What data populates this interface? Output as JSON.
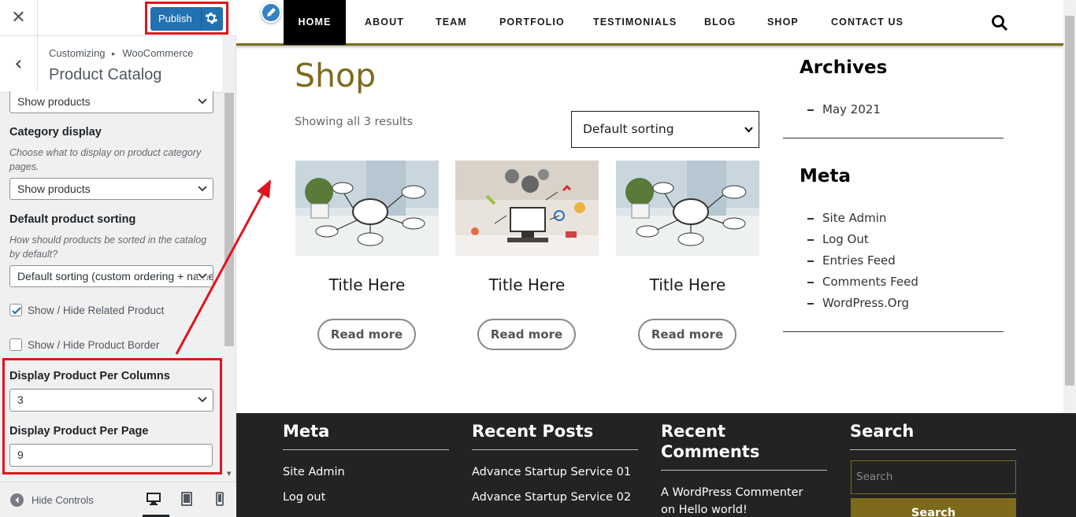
{
  "customizer": {
    "close_glyph": "✕",
    "publish_label": "Publish",
    "back_glyph": "‹",
    "breadcrumb": [
      "Customizing",
      "WooCommerce"
    ],
    "breadcrumb_sep": "▸",
    "section_title": "Product Catalog",
    "shop_page_display_value": "Show products",
    "category_display": {
      "label": "Category display",
      "description": "Choose what to display on product category pages.",
      "value": "Show products"
    },
    "default_sorting": {
      "label": "Default product sorting",
      "description": "How should products be sorted in the catalog by default?",
      "value": "Default sorting (custom ordering + name)"
    },
    "related_product": {
      "label": "Show / Hide Related Product",
      "checked": true
    },
    "product_border": {
      "label": "Show / Hide Product Border",
      "checked": false
    },
    "per_columns": {
      "label": "Display Product Per Columns",
      "value": "3"
    },
    "per_page": {
      "label": "Display Product Per Page",
      "value": "9"
    },
    "hide_controls_label": "Hide Controls",
    "devices": [
      "desktop-icon",
      "tablet-icon",
      "mobile-icon"
    ]
  },
  "site": {
    "nav": [
      "HOME",
      "ABOUT",
      "TEAM",
      "PORTFOLIO",
      "TESTIMONIALS",
      "BLOG",
      "SHOP",
      "CONTACT US"
    ],
    "page_title": "Shop",
    "result_count": "Showing all 3 results",
    "sort_value": "Default sorting",
    "products": [
      {
        "title": "Title Here",
        "button": "Read more"
      },
      {
        "title": "Title Here",
        "button": "Read more"
      },
      {
        "title": "Title Here",
        "button": "Read more"
      }
    ],
    "sidebar": {
      "archives_title": "Archives",
      "archives": [
        "May 2021"
      ],
      "meta_title": "Meta",
      "meta": [
        "Site Admin",
        "Log Out",
        "Entries Feed",
        "Comments Feed",
        "WordPress.Org"
      ]
    },
    "footer": {
      "meta_title": "Meta",
      "meta_links": [
        "Site Admin",
        "Log out"
      ],
      "recent_posts_title": "Recent Posts",
      "recent_posts": [
        "Advance Startup Service 01",
        "Advance Startup Service 02"
      ],
      "recent_comments_title": [
        "Recent",
        "Comments"
      ],
      "recent_comment": [
        "A WordPress Commenter",
        "on Hello world!"
      ],
      "search_title": "Search",
      "search_placeholder": "Search",
      "search_button": "Search"
    }
  },
  "colors": {
    "accent_gold": "#7d6a1b",
    "publish_blue": "#2271b1",
    "annotation_red": "#e0141b",
    "footer_bg": "#232323"
  }
}
